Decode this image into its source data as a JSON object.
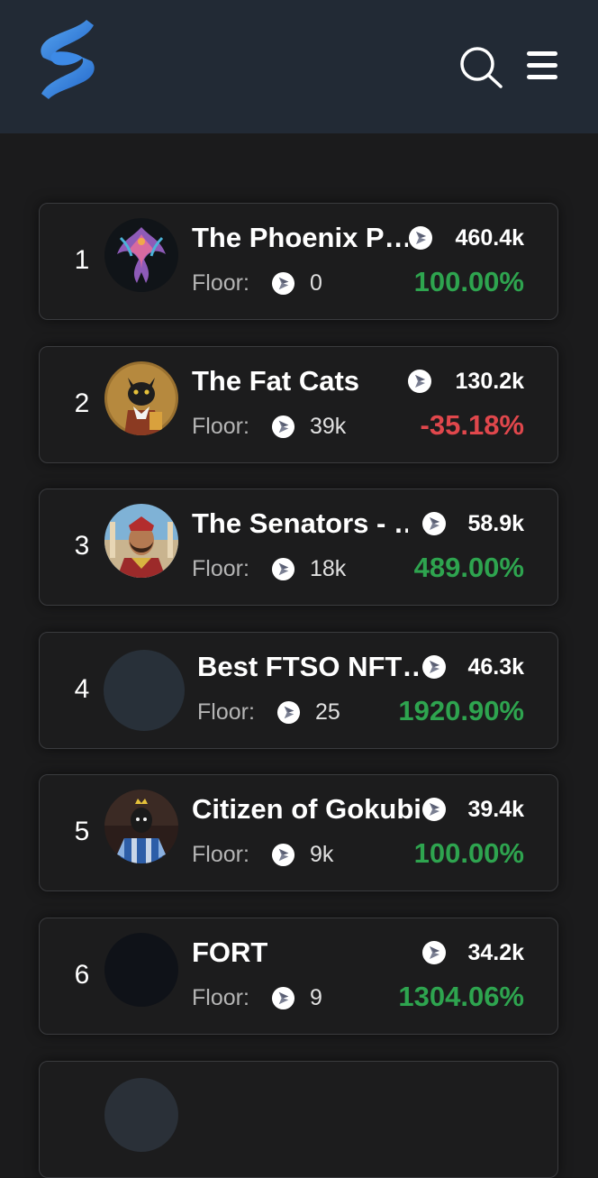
{
  "header": {
    "logo_icon": "brand-s-logo",
    "search_icon": "search-icon",
    "menu_icon": "hamburger-menu-icon"
  },
  "colors": {
    "header_bg": "#222a35",
    "page_bg": "#1b1b1c",
    "positive": "#2ea44f",
    "negative": "#e0474c"
  },
  "collections": [
    {
      "rank": "1",
      "name": "The Phoenix P…",
      "volume": "460.4k",
      "floor_label": "Floor:",
      "floor": "0",
      "change": "100.00%",
      "trend": "positive"
    },
    {
      "rank": "2",
      "name": "The Fat Cats",
      "volume": "130.2k",
      "floor_label": "Floor:",
      "floor": "39k",
      "change": "-35.18%",
      "trend": "negative"
    },
    {
      "rank": "3",
      "name": "The Senators - …",
      "volume": "58.9k",
      "floor_label": "Floor:",
      "floor": "18k",
      "change": "489.00%",
      "trend": "positive"
    },
    {
      "rank": "4",
      "name": "Best FTSO NFT…",
      "volume": "46.3k",
      "floor_label": "Floor:",
      "floor": "25",
      "change": "1920.90%",
      "trend": "positive"
    },
    {
      "rank": "5",
      "name": "Citizen of Gokubi",
      "volume": "39.4k",
      "floor_label": "Floor:",
      "floor": "9k",
      "change": "100.00%",
      "trend": "positive"
    },
    {
      "rank": "6",
      "name": "FORT",
      "volume": "34.2k",
      "floor_label": "Floor:",
      "floor": "9",
      "change": "1304.06%",
      "trend": "positive"
    }
  ]
}
